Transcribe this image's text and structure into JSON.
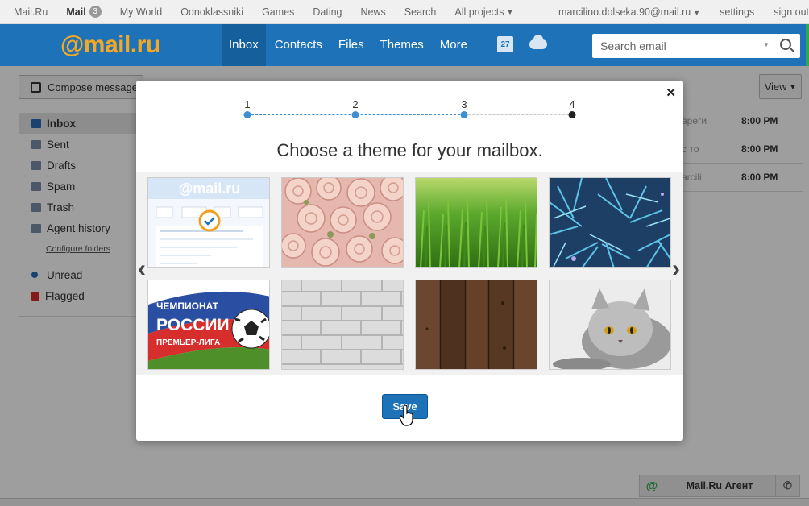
{
  "portal": {
    "links": [
      "Mail.Ru",
      "Mail",
      "My World",
      "Odnoklassniki",
      "Games",
      "Dating",
      "News",
      "Search",
      "All projects"
    ],
    "mail_badge": "3",
    "user_email": "marcilino.dolseka.90@mail.ru",
    "settings": "settings",
    "sign_out": "sign out"
  },
  "header": {
    "logo_at": "@",
    "logo_text": "mail.ru",
    "nav": [
      "Inbox",
      "Contacts",
      "Files",
      "Themes",
      "More"
    ],
    "calendar_day": "27",
    "search_placeholder": "Search email"
  },
  "toolbar": {
    "compose": "Compose message",
    "view": "View"
  },
  "folders": {
    "items": [
      "Inbox",
      "Sent",
      "Drafts",
      "Spam",
      "Trash",
      "Agent history"
    ],
    "configure": "Configure folders",
    "filters": [
      "Unread",
      "Flagged"
    ]
  },
  "messages": [
    {
      "sender": "ареги",
      "time": "8:00 PM"
    },
    {
      "sender": "с то",
      "time": "8:00 PM"
    },
    {
      "sender": "arcili",
      "time": "8:00 PM"
    }
  ],
  "agent": {
    "label": "Mail.Ru Агент"
  },
  "modal": {
    "steps": [
      "1",
      "2",
      "3",
      "4"
    ],
    "current_step": 4,
    "title": "Choose a theme for your mailbox.",
    "selected_theme": 0,
    "themes": [
      "mail-ru-default",
      "pink-roses",
      "green-grass",
      "blue-spruce",
      "russian-football-championship",
      "white-brick",
      "dark-wood",
      "grey-cat"
    ],
    "football": {
      "line1": "ЧЕМПИОНАТ",
      "line2": "РОССИИ",
      "line3": "ПРЕМЬЕР-ЛИГА"
    },
    "default_theme_logo": "@mail.ru",
    "save": "Save"
  },
  "colors": {
    "header_blue": "#1e72b8",
    "logo_orange": "#f7a823",
    "step_blue": "#3d8fd1",
    "check_orange": "#f0a020"
  }
}
